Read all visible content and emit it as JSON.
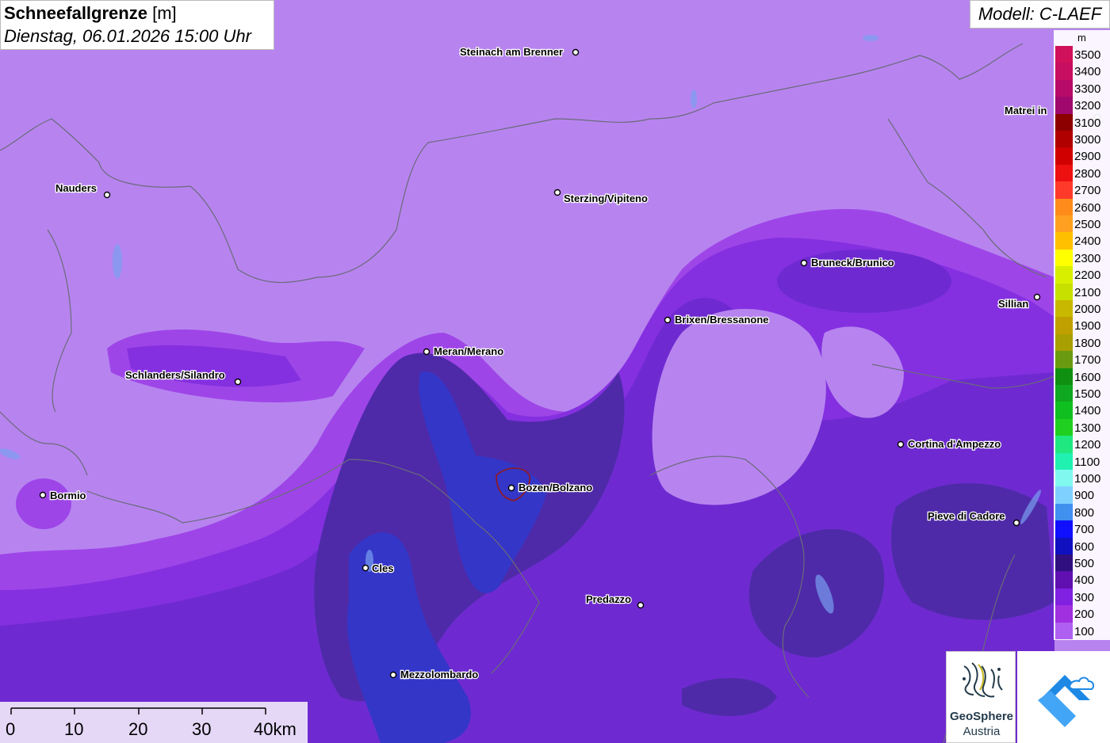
{
  "title": {
    "main": "Schneefallgrenze",
    "unit": "[m]",
    "datetime": "Dienstag, 06.01.2026 15:00 Uhr"
  },
  "model": "Modell: C-LAEF",
  "legend": {
    "unit": "m",
    "levels": [
      {
        "label": "3500",
        "color": "#d0105a"
      },
      {
        "label": "3400",
        "color": "#c80e60"
      },
      {
        "label": "3300",
        "color": "#b80b68"
      },
      {
        "label": "3200",
        "color": "#a0086e"
      },
      {
        "label": "3100",
        "color": "#8c0000"
      },
      {
        "label": "3000",
        "color": "#b00000"
      },
      {
        "label": "2900",
        "color": "#d00000"
      },
      {
        "label": "2800",
        "color": "#ee1010"
      },
      {
        "label": "2700",
        "color": "#ff3a2a"
      },
      {
        "label": "2600",
        "color": "#ff8c1a"
      },
      {
        "label": "2500",
        "color": "#ffa020"
      },
      {
        "label": "2400",
        "color": "#ffc000"
      },
      {
        "label": "2300",
        "color": "#ffff00"
      },
      {
        "label": "2200",
        "color": "#d8f000"
      },
      {
        "label": "2100",
        "color": "#c8e000"
      },
      {
        "label": "2000",
        "color": "#c8b800"
      },
      {
        "label": "1900",
        "color": "#c0a000"
      },
      {
        "label": "1800",
        "color": "#a8a000"
      },
      {
        "label": "1700",
        "color": "#6a9a10"
      },
      {
        "label": "1600",
        "color": "#109010"
      },
      {
        "label": "1500",
        "color": "#10a820"
      },
      {
        "label": "1400",
        "color": "#10c020"
      },
      {
        "label": "1300",
        "color": "#20d020"
      },
      {
        "label": "1200",
        "color": "#20e880"
      },
      {
        "label": "1100",
        "color": "#20f0b0"
      },
      {
        "label": "1000",
        "color": "#80f8f0"
      },
      {
        "label": "900",
        "color": "#80d0ff"
      },
      {
        "label": "800",
        "color": "#4090f0"
      },
      {
        "label": "700",
        "color": "#1010ff"
      },
      {
        "label": "600",
        "color": "#1010c0"
      },
      {
        "label": "500",
        "color": "#301080"
      },
      {
        "label": "400",
        "color": "#6010b0"
      },
      {
        "label": "300",
        "color": "#8020e0"
      },
      {
        "label": "200",
        "color": "#a030e0"
      },
      {
        "label": "100",
        "color": "#b060f0"
      }
    ]
  },
  "cities": [
    {
      "name": "Steinach am Brenner"
    },
    {
      "name": "Matrei in"
    },
    {
      "name": "Nauders"
    },
    {
      "name": "Sterzing/Vipiteno"
    },
    {
      "name": "Bruneck/Brunico"
    },
    {
      "name": "Sillian"
    },
    {
      "name": "Brixen/Bressanone"
    },
    {
      "name": "Meran/Merano"
    },
    {
      "name": "Schlanders/Silandro"
    },
    {
      "name": "Cortina d'Ampezzo"
    },
    {
      "name": "Bozen/Bolzano"
    },
    {
      "name": "Bormio"
    },
    {
      "name": "Pieve di Cadore"
    },
    {
      "name": "Cles"
    },
    {
      "name": "Predazzo"
    },
    {
      "name": "Mezzolombardo"
    }
  ],
  "scale_bar": {
    "ticks": [
      "0",
      "10",
      "20",
      "30",
      "40km"
    ]
  },
  "logos": {
    "geosphere_line1": "GeoSphere",
    "geosphere_line2": "Austria",
    "geosphere_icon": "geosphere-logo-icon",
    "second_icon": "cloud-arrow-logo-icon"
  }
}
